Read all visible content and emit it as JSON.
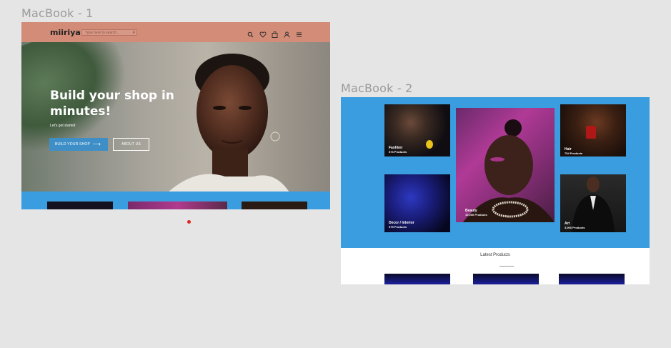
{
  "frames": {
    "frame1_label": "MacBook - 1",
    "frame2_label": "MacBook - 2"
  },
  "macbook1": {
    "logo": "miiriya",
    "search_placeholder": "Type here to search...",
    "hero_title": "Build your shop in minutes!",
    "hero_subtitle": "Let's get started",
    "primary_button": "BUILD YOUR SHOP",
    "secondary_button": "ABOUT US"
  },
  "macbook2": {
    "categories": [
      {
        "name": "Fashion",
        "count": "573 Products"
      },
      {
        "name": "Beauty",
        "count": "10,000 Products"
      },
      {
        "name": "Hair",
        "count": "754 Products"
      },
      {
        "name": "Decor / Interior",
        "count": "975 Products"
      },
      {
        "name": "Art",
        "count": "3,000 Products"
      }
    ],
    "latest_title": "Latest Products"
  },
  "colors": {
    "nav": "#d28c78",
    "accent_blue": "#3a9de0",
    "button_blue": "#3e8fc7",
    "indicator": "#e0241f"
  },
  "icons": [
    "search-icon",
    "heart-icon",
    "bag-icon",
    "user-icon",
    "menu-icon",
    "arrow-right-icon"
  ]
}
